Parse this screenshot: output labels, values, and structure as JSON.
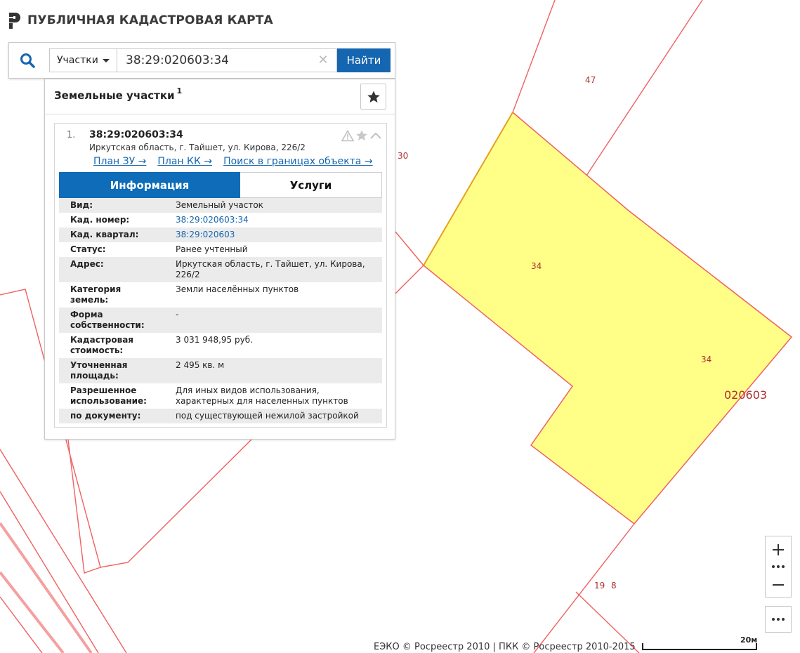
{
  "app": {
    "title": "ПУБЛИЧНАЯ КАДАСТРОВАЯ КАРТА"
  },
  "search": {
    "type_label": "Участки",
    "query": "38:29:020603:34",
    "find_label": "Найти"
  },
  "panel": {
    "title": "Земельные участки",
    "count": "1"
  },
  "result": {
    "number": "1.",
    "cad_number": "38:29:020603:34",
    "address": "Иркутская область, г. Тайшет, ул. Кирова, 226/2",
    "links": [
      "План ЗУ →",
      "План КК →",
      "Поиск в границах объекта →"
    ],
    "tabs": [
      "Информация",
      "Услуги"
    ],
    "rows": [
      {
        "k": "Вид:",
        "v": "Земельный участок"
      },
      {
        "k": "Кад. номер:",
        "v": "38:29:020603:34"
      },
      {
        "k": "Кад. квартал:",
        "v": "38:29:020603"
      },
      {
        "k": "Статус:",
        "v": "Ранее учтенный"
      },
      {
        "k": "Адрес:",
        "v": "Иркутская область, г. Тайшет, ул. Кирова, 226/2"
      },
      {
        "k": "Категория земель:",
        "v": "Земли населённых пунктов"
      },
      {
        "k": "Форма собственности:",
        "v": "-"
      },
      {
        "k": "Кадастровая стоимость:",
        "v": "3 031 948,95 руб."
      },
      {
        "k": "Уточненная площадь:",
        "v": "2 495 кв. м"
      },
      {
        "k": "Разрешенное использование:",
        "v": "Для иных видов использования, характерных для населенных пунктов"
      },
      {
        "k": "по документу:",
        "v": "под существующей нежилой застройкой"
      }
    ]
  },
  "map": {
    "labels": {
      "p47": "47",
      "p30": "30",
      "p34a": "34",
      "p34b": "34",
      "quarter": "020603",
      "p19": "19",
      "p8": "8"
    },
    "colors": {
      "boundary": "#f06060",
      "selected_fill": "#ffff88",
      "selected_stroke": "#e8a020"
    }
  },
  "footer": {
    "attribution": "ЕЭКО © Росреестр 2010 | ПКК © Росреестр 2010-2015",
    "scale": "20м"
  },
  "icons": [
    "logo-icon",
    "search-icon",
    "chevron-down-icon",
    "close-icon",
    "star-icon",
    "warning-icon",
    "chevron-up-icon",
    "plus-icon",
    "minus-icon",
    "more-icon"
  ]
}
